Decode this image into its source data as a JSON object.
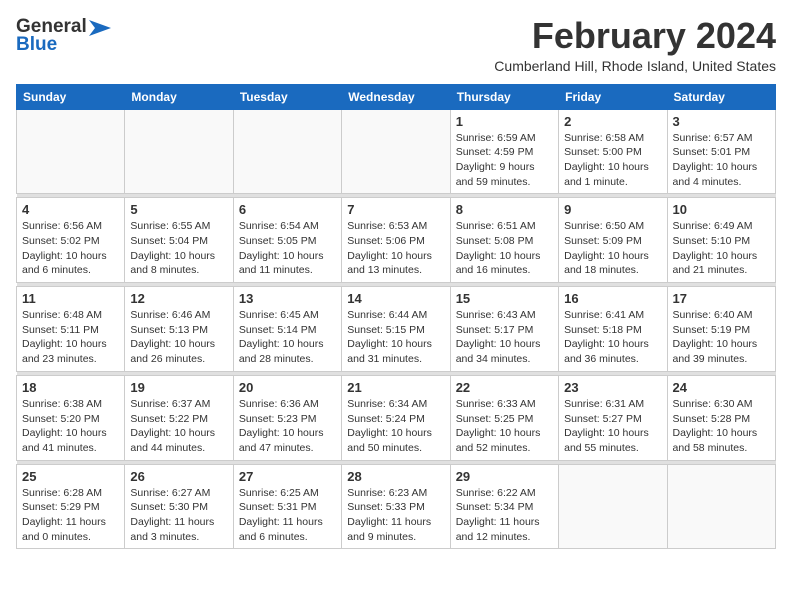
{
  "logo": {
    "line1": "General",
    "line2": "Blue"
  },
  "header": {
    "title": "February 2024",
    "subtitle": "Cumberland Hill, Rhode Island, United States"
  },
  "weekdays": [
    "Sunday",
    "Monday",
    "Tuesday",
    "Wednesday",
    "Thursday",
    "Friday",
    "Saturday"
  ],
  "weeks": [
    [
      {
        "day": "",
        "info": ""
      },
      {
        "day": "",
        "info": ""
      },
      {
        "day": "",
        "info": ""
      },
      {
        "day": "",
        "info": ""
      },
      {
        "day": "1",
        "info": "Sunrise: 6:59 AM\nSunset: 4:59 PM\nDaylight: 9 hours\nand 59 minutes."
      },
      {
        "day": "2",
        "info": "Sunrise: 6:58 AM\nSunset: 5:00 PM\nDaylight: 10 hours\nand 1 minute."
      },
      {
        "day": "3",
        "info": "Sunrise: 6:57 AM\nSunset: 5:01 PM\nDaylight: 10 hours\nand 4 minutes."
      }
    ],
    [
      {
        "day": "4",
        "info": "Sunrise: 6:56 AM\nSunset: 5:02 PM\nDaylight: 10 hours\nand 6 minutes."
      },
      {
        "day": "5",
        "info": "Sunrise: 6:55 AM\nSunset: 5:04 PM\nDaylight: 10 hours\nand 8 minutes."
      },
      {
        "day": "6",
        "info": "Sunrise: 6:54 AM\nSunset: 5:05 PM\nDaylight: 10 hours\nand 11 minutes."
      },
      {
        "day": "7",
        "info": "Sunrise: 6:53 AM\nSunset: 5:06 PM\nDaylight: 10 hours\nand 13 minutes."
      },
      {
        "day": "8",
        "info": "Sunrise: 6:51 AM\nSunset: 5:08 PM\nDaylight: 10 hours\nand 16 minutes."
      },
      {
        "day": "9",
        "info": "Sunrise: 6:50 AM\nSunset: 5:09 PM\nDaylight: 10 hours\nand 18 minutes."
      },
      {
        "day": "10",
        "info": "Sunrise: 6:49 AM\nSunset: 5:10 PM\nDaylight: 10 hours\nand 21 minutes."
      }
    ],
    [
      {
        "day": "11",
        "info": "Sunrise: 6:48 AM\nSunset: 5:11 PM\nDaylight: 10 hours\nand 23 minutes."
      },
      {
        "day": "12",
        "info": "Sunrise: 6:46 AM\nSunset: 5:13 PM\nDaylight: 10 hours\nand 26 minutes."
      },
      {
        "day": "13",
        "info": "Sunrise: 6:45 AM\nSunset: 5:14 PM\nDaylight: 10 hours\nand 28 minutes."
      },
      {
        "day": "14",
        "info": "Sunrise: 6:44 AM\nSunset: 5:15 PM\nDaylight: 10 hours\nand 31 minutes."
      },
      {
        "day": "15",
        "info": "Sunrise: 6:43 AM\nSunset: 5:17 PM\nDaylight: 10 hours\nand 34 minutes."
      },
      {
        "day": "16",
        "info": "Sunrise: 6:41 AM\nSunset: 5:18 PM\nDaylight: 10 hours\nand 36 minutes."
      },
      {
        "day": "17",
        "info": "Sunrise: 6:40 AM\nSunset: 5:19 PM\nDaylight: 10 hours\nand 39 minutes."
      }
    ],
    [
      {
        "day": "18",
        "info": "Sunrise: 6:38 AM\nSunset: 5:20 PM\nDaylight: 10 hours\nand 41 minutes."
      },
      {
        "day": "19",
        "info": "Sunrise: 6:37 AM\nSunset: 5:22 PM\nDaylight: 10 hours\nand 44 minutes."
      },
      {
        "day": "20",
        "info": "Sunrise: 6:36 AM\nSunset: 5:23 PM\nDaylight: 10 hours\nand 47 minutes."
      },
      {
        "day": "21",
        "info": "Sunrise: 6:34 AM\nSunset: 5:24 PM\nDaylight: 10 hours\nand 50 minutes."
      },
      {
        "day": "22",
        "info": "Sunrise: 6:33 AM\nSunset: 5:25 PM\nDaylight: 10 hours\nand 52 minutes."
      },
      {
        "day": "23",
        "info": "Sunrise: 6:31 AM\nSunset: 5:27 PM\nDaylight: 10 hours\nand 55 minutes."
      },
      {
        "day": "24",
        "info": "Sunrise: 6:30 AM\nSunset: 5:28 PM\nDaylight: 10 hours\nand 58 minutes."
      }
    ],
    [
      {
        "day": "25",
        "info": "Sunrise: 6:28 AM\nSunset: 5:29 PM\nDaylight: 11 hours\nand 0 minutes."
      },
      {
        "day": "26",
        "info": "Sunrise: 6:27 AM\nSunset: 5:30 PM\nDaylight: 11 hours\nand 3 minutes."
      },
      {
        "day": "27",
        "info": "Sunrise: 6:25 AM\nSunset: 5:31 PM\nDaylight: 11 hours\nand 6 minutes."
      },
      {
        "day": "28",
        "info": "Sunrise: 6:23 AM\nSunset: 5:33 PM\nDaylight: 11 hours\nand 9 minutes."
      },
      {
        "day": "29",
        "info": "Sunrise: 6:22 AM\nSunset: 5:34 PM\nDaylight: 11 hours\nand 12 minutes."
      },
      {
        "day": "",
        "info": ""
      },
      {
        "day": "",
        "info": ""
      }
    ]
  ],
  "colors": {
    "header_bg": "#1a6abf",
    "header_text": "#ffffff",
    "border": "#cccccc",
    "empty_bg": "#f9f9f9"
  }
}
